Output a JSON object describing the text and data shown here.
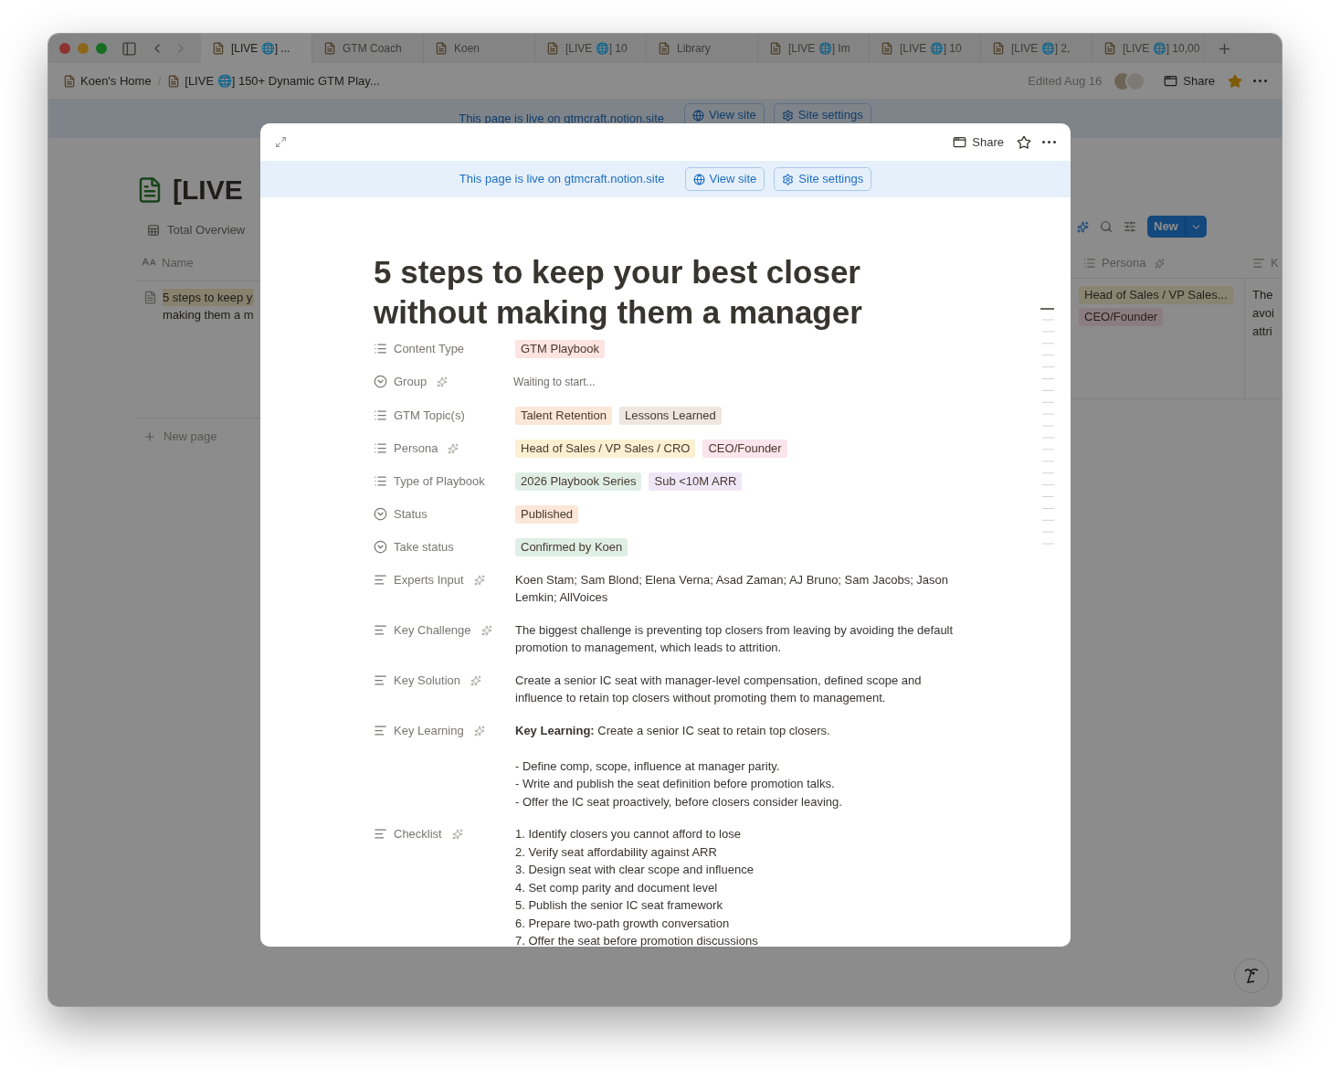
{
  "tabs": [
    {
      "label": "[LIVE 🌐] ...",
      "selected": true
    },
    {
      "label": "GTM Coach",
      "selected": false
    },
    {
      "label": "Koen",
      "selected": false
    },
    {
      "label": "[LIVE 🌐] 10",
      "selected": false
    },
    {
      "label": "Library",
      "selected": false
    },
    {
      "label": "[LIVE 🌐] Im",
      "selected": false
    },
    {
      "label": "[LIVE 🌐] 10",
      "selected": false
    },
    {
      "label": "[LIVE 🌐] 2,",
      "selected": false
    },
    {
      "label": "[LIVE 🌐] 10,00",
      "selected": false
    }
  ],
  "breadcrumb": [
    "Koen's Home",
    "[LIVE 🌐] 150+ Dynamic GTM Play..."
  ],
  "breadcrumb_separator": "/",
  "topbar": {
    "edited": "Edited Aug 16",
    "share": "Share",
    "favorite": true
  },
  "background": {
    "banner": {
      "text": "This page is live on gtmcraft.notion.site",
      "view_site": "View site",
      "site_settings": "Site settings"
    },
    "title": "[LIVE",
    "view_tab": "Total Overview",
    "name_column": "Name",
    "row_lines": [
      "5 steps to keep y",
      "making them a m"
    ],
    "new_page": "New page",
    "new_button": "New",
    "persona_column": "Persona",
    "column_3": "K",
    "persona_tags": [
      "Head of Sales / VP Sales...",
      "CEO/Founder"
    ],
    "cell_lines": [
      "The",
      "avoi",
      "attri"
    ]
  },
  "modal": {
    "share": "Share",
    "favorite": false,
    "banner": {
      "text": "This page is live on gtmcraft.notion.site",
      "view_site": "View site",
      "site_settings": "Site settings"
    },
    "title": "5 steps to keep your best closer without making them a manager",
    "properties": [
      {
        "kind": "multi_select",
        "label": "Content Type",
        "ai": false,
        "tags": [
          {
            "label": "GTM Playbook",
            "color": "#fde4e1"
          }
        ]
      },
      {
        "kind": "status",
        "label": "Group",
        "ai": true,
        "pending": "Waiting to start..."
      },
      {
        "kind": "multi_select",
        "label": "GTM Topic(s)",
        "ai": false,
        "tags": [
          {
            "label": "Talent Retention",
            "color": "#fbe6d8"
          },
          {
            "label": "Lessons Learned",
            "color": "#eee6e1"
          }
        ]
      },
      {
        "kind": "multi_select",
        "label": "Persona",
        "ai": true,
        "tags": [
          {
            "label": "Head of Sales / VP Sales / CRO",
            "color": "#fbf0d2"
          },
          {
            "label": "CEO/Founder",
            "color": "#fbe4ec"
          }
        ]
      },
      {
        "kind": "multi_select",
        "label": "Type of Playbook",
        "ai": false,
        "tags": [
          {
            "label": "2026 Playbook Series",
            "color": "#e0efe6"
          },
          {
            "label": "Sub <10M ARR",
            "color": "#efe6f7"
          }
        ]
      },
      {
        "kind": "status",
        "label": "Status",
        "ai": false,
        "tags": [
          {
            "label": "Published",
            "color": "#fbe6d8"
          }
        ]
      },
      {
        "kind": "status",
        "label": "Take status",
        "ai": false,
        "tags": [
          {
            "label": "Confirmed by Koen",
            "color": "#e0efe6"
          }
        ]
      },
      {
        "kind": "text",
        "label": "Experts Input",
        "ai": true,
        "lines": [
          "Koen Stam; Sam Blond; Elena Verna; Asad Zaman; AJ Bruno; Sam Jacobs; Jason Lemkin; AllVoices"
        ]
      },
      {
        "kind": "text",
        "label": "Key Challenge",
        "ai": true,
        "lines": [
          "The biggest challenge is preventing top closers from leaving by avoiding the default promotion to management, which leads to attrition."
        ]
      },
      {
        "kind": "text",
        "label": "Key Solution",
        "ai": true,
        "lines": [
          "Create a senior IC seat with manager-level compensation, defined scope and influence to retain top closers without promoting them to management."
        ]
      },
      {
        "kind": "text",
        "label": "Key Learning",
        "ai": true,
        "lines": [
          "**Key Learning:** Create a senior IC seat to retain top closers.",
          "- Define comp, scope, influence at manager parity.",
          "- Write and publish the seat definition before promotion talks.",
          "- Offer the IC seat proactively, before closers consider leaving."
        ]
      },
      {
        "kind": "text",
        "label": "Checklist",
        "ai": true,
        "lines": [
          "1. Identify closers you cannot afford to lose",
          "2. Verify seat affordability against ARR",
          "3. Design seat with clear scope and influence",
          "4. Set comp parity and document level",
          "5. Publish the senior IC seat framework",
          "6. Prepare two-path growth conversation",
          "7. Offer the seat before promotion discussions"
        ]
      }
    ]
  }
}
